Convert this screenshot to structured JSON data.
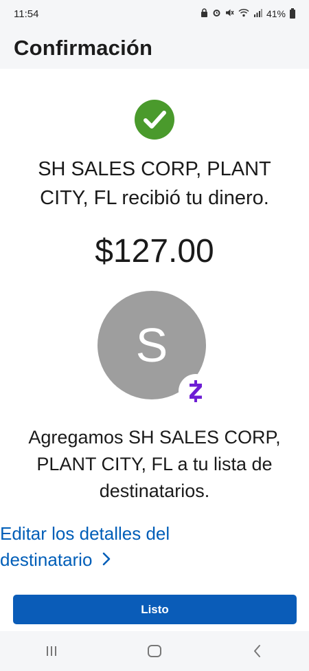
{
  "status_bar": {
    "time": "11:54",
    "battery": "41%"
  },
  "header": {
    "title": "Confirmación"
  },
  "confirmation": {
    "message": "SH SALES CORP, PLANT CITY, FL recibió tu dinero.",
    "amount": "$127.00",
    "avatar_letter": "S",
    "added_message": "Agregamos SH SALES CORP, PLANT CITY, FL a tu lista de destinatarios.",
    "edit_link": "Editar los detalles del destinatario",
    "done_button": "Listo"
  },
  "colors": {
    "success_green": "#4a9a2c",
    "link_blue": "#005eb8",
    "button_blue": "#0a5cb8",
    "zelle_purple": "#6d1ed4",
    "avatar_gray": "#9e9e9e"
  },
  "icons": {
    "status": [
      "lock-icon",
      "alarm-icon",
      "mute-icon",
      "wifi-icon",
      "signal-icon",
      "battery-icon"
    ],
    "success": "check-circle-icon",
    "badge": "zelle-icon",
    "link": "chevron-right-icon",
    "nav": [
      "recent-apps-icon",
      "home-icon",
      "back-icon"
    ]
  }
}
